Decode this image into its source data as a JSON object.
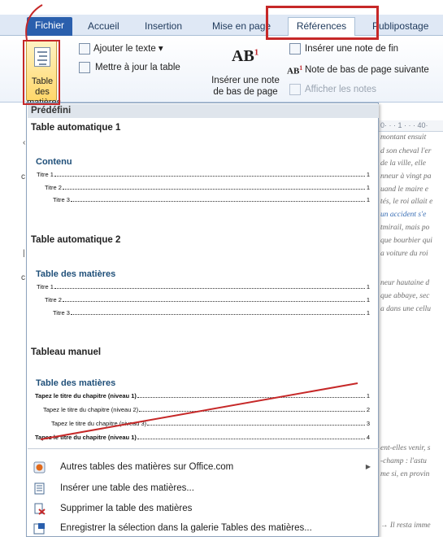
{
  "ribbon": {
    "tabs": [
      {
        "label": "Fichier"
      },
      {
        "label": "Accueil"
      },
      {
        "label": "Insertion"
      },
      {
        "label": "Mise en page"
      },
      {
        "label": "Références"
      },
      {
        "label": "Publipostage"
      }
    ],
    "toc_button_label": "Table des matières",
    "add_text_label": "Ajouter le texte",
    "update_table_label": "Mettre à jour la table",
    "insert_footnote_label": "Insérer une note de bas de page",
    "insert_endnote_label": "Insérer une note de fin",
    "next_footnote_label": "Note de bas de page suivante",
    "show_notes_label": "Afficher les notes"
  },
  "gallery": {
    "section_label": "Prédéfini",
    "auto1": {
      "title": "Table automatique 1",
      "heading": "Contenu",
      "lines": [
        {
          "label": "Titre 1",
          "page": "1"
        },
        {
          "label": "Titre 2",
          "page": "1"
        },
        {
          "label": "Titre 3",
          "page": "1"
        }
      ]
    },
    "auto2": {
      "title": "Table automatique 2",
      "heading": "Table des matières",
      "lines": [
        {
          "label": "Titre 1",
          "page": "1"
        },
        {
          "label": "Titre 2",
          "page": "1"
        },
        {
          "label": "Titre 3",
          "page": "1"
        }
      ]
    },
    "manual": {
      "title": "Tableau manuel",
      "heading": "Table des matières",
      "lines": [
        {
          "label": "Tapez le titre du chapitre (niveau 1)",
          "page": "1"
        },
        {
          "label": "Tapez le titre du chapitre (niveau 2)",
          "page": "2"
        },
        {
          "label": "Tapez le titre du chapitre (niveau 3)",
          "page": "3"
        },
        {
          "label": "Tapez le titre du chapitre (niveau 1)",
          "page": "4"
        }
      ]
    }
  },
  "menu": {
    "items": [
      {
        "label": "Autres tables des matières sur Office.com"
      },
      {
        "label": "Insérer une table des matières..."
      },
      {
        "label": "Supprimer la table des matières"
      },
      {
        "label": "Enregistrer la sélection dans la galerie Tables des matières..."
      }
    ]
  },
  "document": {
    "ruler_text": "0· · · 1 · · · 40·",
    "lines": [
      "montant ensuit",
      "d son cheval l'er",
      "de la ville, elle",
      "nneur à vingt pa",
      "uand le maire e",
      "tés, le roi allait e",
      "un accident s'e",
      "tmirail, mais po",
      "que bourbier qui",
      "a voiture du roi",
      "neur hautaine d",
      "que abbaye, sec",
      "a dans une cellu",
      "ent-elles venir, s",
      "-champ : l'astu",
      "me si, en provin",
      "→ Il resta imme"
    ]
  },
  "colors": {
    "file_tab": "#2a5fad",
    "highlight": "#c62828",
    "toc_heading": "#1f4f79"
  }
}
